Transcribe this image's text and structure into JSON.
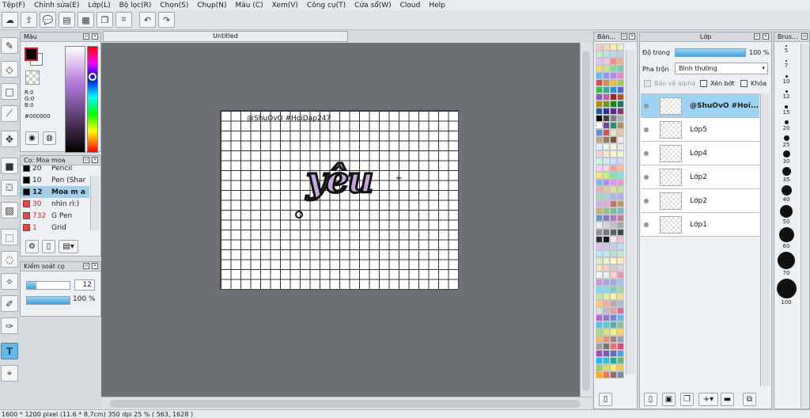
{
  "menu": [
    "Tệp(F)",
    "Chỉnh sửa(E)",
    "Lớp(L)",
    "Bộ lọc(R)",
    "Chọn(S)",
    "Chụp(N)",
    "Màu (C)",
    "Xem(V)",
    "Công cụ(T)",
    "Cửa sổ(W)",
    "Cloud",
    "Help"
  ],
  "document": {
    "tab_title": "Untitled",
    "watermark": "@ShuOvO #HoiDap247",
    "art_text": "yêu"
  },
  "color_panel": {
    "title": "Màu",
    "r": "R:0",
    "g": "G:0",
    "b": "B:0",
    "hex": "#000000",
    "fg_color": "#000000",
    "bg_color": "#ffffff"
  },
  "brush_panel": {
    "title": "Cọ: Moa moa",
    "items": [
      {
        "size": "20",
        "name": "Pencil",
        "color": "#000000"
      },
      {
        "size": "10",
        "name": "Pen (Shar",
        "color": "#000000"
      },
      {
        "size": "12",
        "name": "Moa m a",
        "color": "#000000"
      },
      {
        "size": "30",
        "name": "nhìn rì:)",
        "color": "#ee4444"
      },
      {
        "size": "732",
        "name": "G Pen",
        "color": "#ee4444"
      },
      {
        "size": "1",
        "name": "Grid",
        "color": "#ee4444"
      }
    ],
    "selected_index": 2
  },
  "brush_control": {
    "title": "Kiểm soát cọ",
    "size_value": "12",
    "opacity_value": "100 %",
    "size_fraction": 0.22,
    "opacity_fraction": 1.0
  },
  "palette_panel": {
    "title": "Bản..."
  },
  "layer_panel": {
    "title": "Lớp",
    "opacity_label": "Độ trong",
    "opacity_value": "100 %",
    "blend_label": "Pha trộn",
    "blend_value": "Bình thường",
    "protect_alpha": "Bảo vệ alpha",
    "clipping": "Xén bớt",
    "lock": "Khóa",
    "layers": [
      "@ShuOvO #Hoi...",
      "Lớp5",
      "Lớp4",
      "Lớp2",
      "Lớp2",
      "Lớp1"
    ],
    "selected_index": 0
  },
  "brush_size_panel": {
    "title": "Brus...",
    "sizes": [
      "5",
      "7",
      "10",
      "12",
      "15",
      "20",
      "25",
      "30",
      "35",
      "40",
      "50",
      "60",
      "70",
      "100"
    ]
  },
  "status": "1600 * 1200 pixel   (11.6 * 8.7cm)   350 dpi   25 %   ( 563, 1628 )",
  "palette_colors": [
    "#f6c9c9",
    "#f9d6b5",
    "#fbeab0",
    "#e8f5b8",
    "#c8efc0",
    "#b6e8d8",
    "#b8dcef",
    "#c6cdf1",
    "#d8c6ef",
    "#efc6e3",
    "#ef8a8a",
    "#f2b07a",
    "#f5d86e",
    "#c9e87a",
    "#88d98a",
    "#6fd1b8",
    "#6fb8e6",
    "#8b96e6",
    "#b08be6",
    "#e68bc8",
    "#e04848",
    "#e8873a",
    "#e8c030",
    "#9fd040",
    "#42b84a",
    "#30b08e",
    "#3090d0",
    "#5562d0",
    "#8a55d0",
    "#d055a8",
    "#a82020",
    "#b05a18",
    "#b08c10",
    "#6a9a18",
    "#1e7f28",
    "#187a60",
    "#1a5f98",
    "#2c3699",
    "#5a2c99",
    "#992c72",
    "#000000",
    "#404040",
    "#808080",
    "#b0b0b0",
    "#ffffff",
    "#7b3fa0",
    "#2a8a6a",
    "#c88a4a",
    "#6a8ac8",
    "#c85a5a",
    "#f3e0c6",
    "#e6c9a0",
    "#c9a67a",
    "#a07a50",
    "#7a5630",
    "#fbe3e6",
    "#e3f0fb",
    "#e6fbe3",
    "#fbf7e3",
    "#efe3fb",
    "#ffd0d0",
    "#ffe6cc",
    "#fff4c2",
    "#e8ffc9",
    "#ccf5d9",
    "#ccf0f5",
    "#cce0ff",
    "#dcd0ff",
    "#f3d0ff",
    "#ffd0ec",
    "#ff9a9a",
    "#ffbf80",
    "#ffe880",
    "#c9f27a",
    "#80e6a8",
    "#80e0ea",
    "#80b8ff",
    "#a890ff",
    "#e090ff",
    "#ff90d0",
    "#e6b0b0",
    "#e6c8a0",
    "#e6dca0",
    "#c8e0a0",
    "#a0d8b8",
    "#a0d6dc",
    "#a0bfe6",
    "#b8ace6",
    "#d4ace6",
    "#e6acd0",
    "#c47070",
    "#c4956a",
    "#c4b46a",
    "#95c46a",
    "#6ac490",
    "#6ac0c4",
    "#6a98c4",
    "#8a7ac4",
    "#b07ac4",
    "#c47aa6",
    "#f0f0f0",
    "#d8d8d8",
    "#c0c0c0",
    "#a8a8a8",
    "#909090",
    "#787878",
    "#606060",
    "#484848",
    "#303030",
    "#181818",
    "#fce4ec",
    "#f8bbd0",
    "#e1bee7",
    "#d1c4e9",
    "#c5cae9",
    "#bbdefb",
    "#b3e5fc",
    "#b2ebf2",
    "#b2dfdb",
    "#c8e6c9",
    "#dcedc8",
    "#f0f4c3",
    "#fff9c4",
    "#ffecb3",
    "#ffe0b2",
    "#ffccbc",
    "#d7ccc8",
    "#cfd8dc",
    "#f5f5f5",
    "#eeeeee",
    "#ffcdd2",
    "#f48fb1",
    "#ce93d8",
    "#b39ddb",
    "#9fa8da",
    "#90caf9",
    "#81d4fa",
    "#80deea",
    "#80cbc4",
    "#a5d6a7",
    "#c5e1a5",
    "#e6ee9c",
    "#fff59d",
    "#ffe082",
    "#ffcc80",
    "#ffab91",
    "#bcaaa4",
    "#b0bec5",
    "#e0e0e0",
    "#bdbdbd",
    "#ef9a9a",
    "#f06292",
    "#ba68c8",
    "#9575cd",
    "#7986cb",
    "#64b5f6",
    "#4fc3f7",
    "#4dd0e1",
    "#4db6ac",
    "#81c784",
    "#aed581",
    "#dce775",
    "#fff176",
    "#ffd54f",
    "#ffb74d",
    "#ff8a65",
    "#a1887f",
    "#90a4ae",
    "#9e9e9e",
    "#757575",
    "#e57373",
    "#ec407a",
    "#ab47bc",
    "#7e57c2",
    "#5c6bc0",
    "#42a5f5",
    "#29b6f6",
    "#26c6da",
    "#26a69a",
    "#66bb6a",
    "#9ccc65",
    "#d4e157",
    "#ffee58",
    "#ffca28",
    "#ffa726",
    "#ff7043",
    "#8d6e63",
    "#78909c",
    "#616161",
    "#424242"
  ]
}
